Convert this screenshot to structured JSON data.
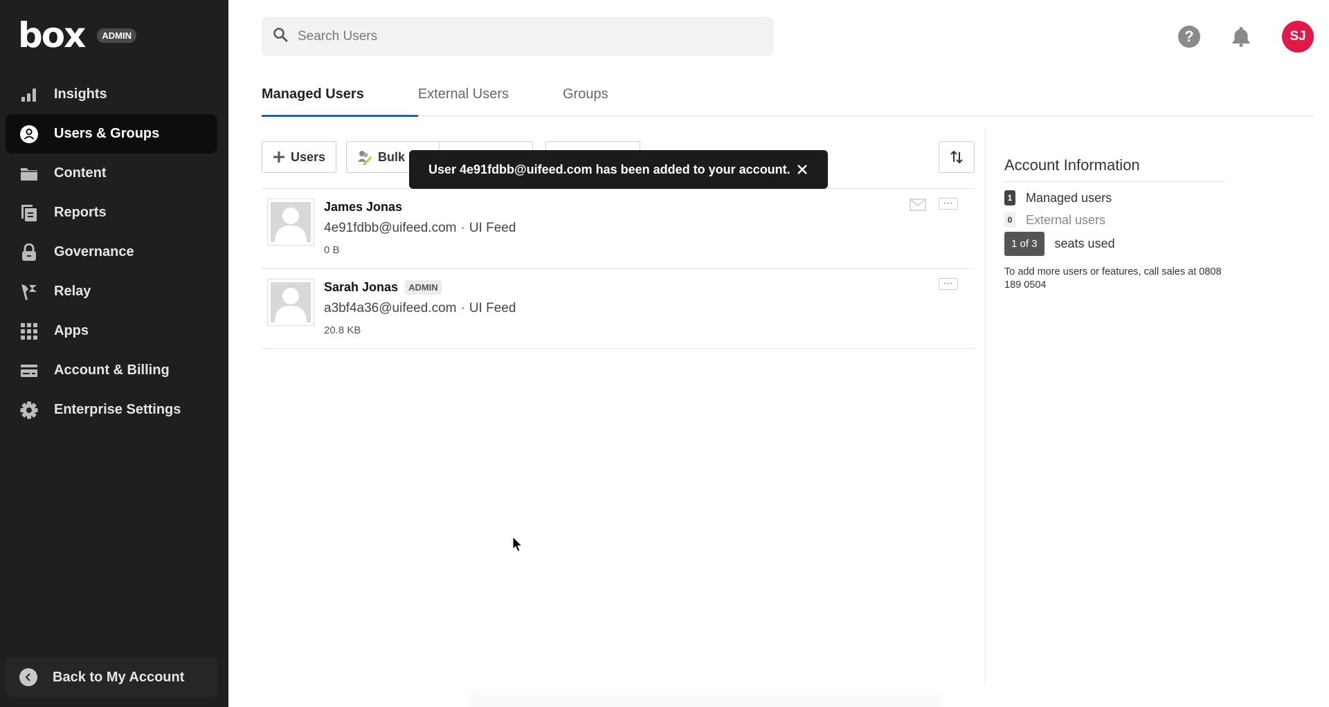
{
  "sidebar": {
    "logo": "box",
    "admin_badge": "ADMIN",
    "items": [
      {
        "label": "Insights",
        "icon": "bar-chart-icon",
        "active": false
      },
      {
        "label": "Users & Groups",
        "icon": "user-circle-icon",
        "active": true
      },
      {
        "label": "Content",
        "icon": "folder-icon",
        "active": false
      },
      {
        "label": "Reports",
        "icon": "reports-icon",
        "active": false
      },
      {
        "label": "Governance",
        "icon": "lock-icon",
        "active": false
      },
      {
        "label": "Relay",
        "icon": "relay-flag-icon",
        "active": false
      },
      {
        "label": "Apps",
        "icon": "grid-icon",
        "active": false
      },
      {
        "label": "Account & Billing",
        "icon": "credit-card-icon",
        "active": false
      },
      {
        "label": "Enterprise Settings",
        "icon": "gear-icon",
        "active": false
      }
    ],
    "back_label": "Back to My Account"
  },
  "header": {
    "search_placeholder": "Search Users",
    "help_glyph": "?",
    "avatar_initials": "SJ",
    "avatar_color": "#e0194a"
  },
  "tabs": [
    {
      "label": "Managed Users",
      "active": true
    },
    {
      "label": "External Users",
      "active": false
    },
    {
      "label": "Groups",
      "active": false
    }
  ],
  "toolbar": {
    "add_users_label": "Users",
    "bulk_label": "Bulk E",
    "button3_label": "",
    "button4_label": ""
  },
  "toast": {
    "message": "User 4e91fdbb@uifeed.com has been added to your account."
  },
  "users": [
    {
      "name": "James Jonas",
      "badge": "",
      "email": "4e91fdbb@uifeed.com",
      "separator": "·",
      "org": "UI Feed",
      "storage": "0 B",
      "has_mail_icon": true
    },
    {
      "name": "Sarah Jonas",
      "badge": "ADMIN",
      "email": "a3bf4a36@uifeed.com",
      "separator": "·",
      "org": "UI Feed",
      "storage": "20.8 KB",
      "has_mail_icon": false
    }
  ],
  "account_info": {
    "title": "Account Information",
    "managed_count": "1",
    "managed_label": "Managed users",
    "external_count": "0",
    "external_label": "External users",
    "seats_badge": "1 of 3",
    "seats_label": "seats used",
    "note": "To add more users or features, call sales at 0808 189 0504"
  },
  "colors": {
    "sidebar_bg": "#1f1f1f",
    "tab_accent": "#1f5cbf",
    "toast_bg": "#1c1c1c"
  }
}
